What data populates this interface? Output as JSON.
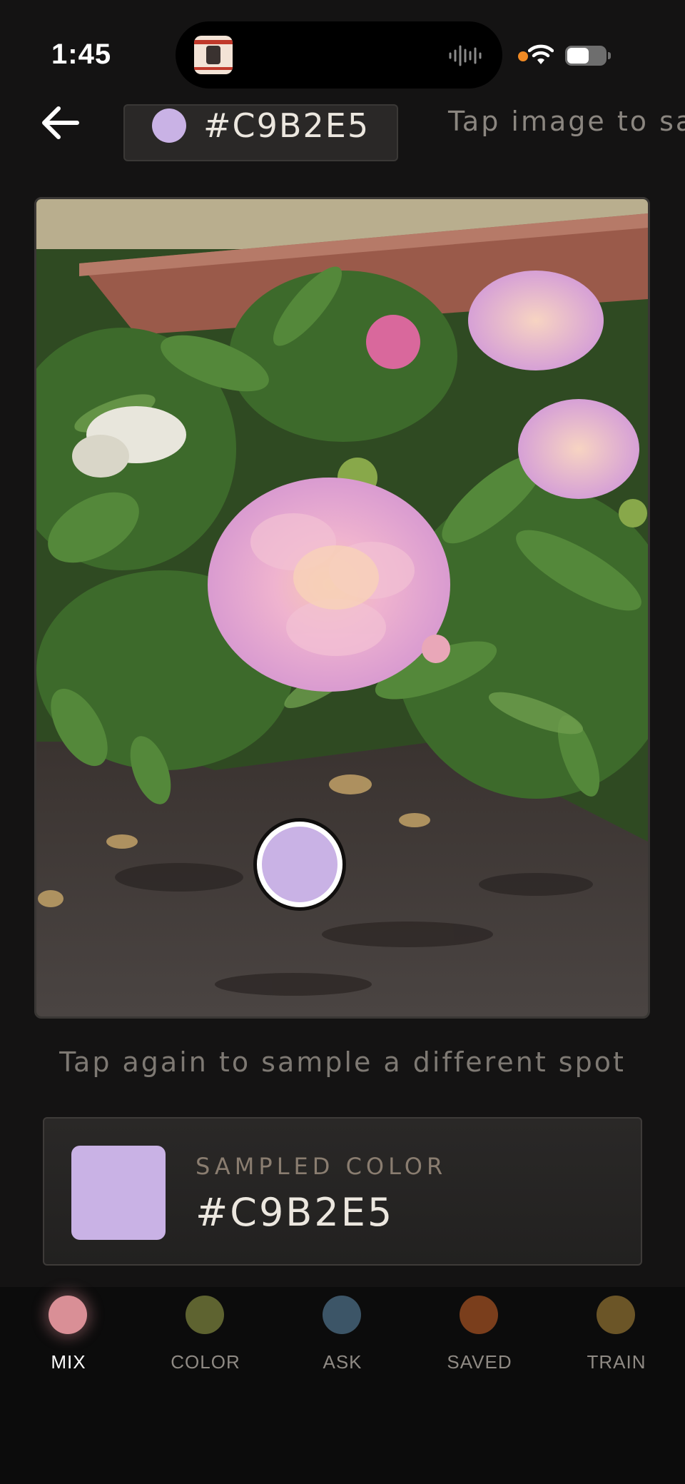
{
  "status_bar": {
    "time": "1:45"
  },
  "header": {
    "selected_hex": "#C9B2E5",
    "hint": "Tap image to sa"
  },
  "photo": {
    "subject": "pink peony bush photo",
    "sample_color": "#C9B2E5"
  },
  "hint_bottom": "Tap again to sample a different spot",
  "sampled": {
    "label": "SAMPLED COLOR",
    "hex": "#C9B2E5",
    "color": "#C9B2E5"
  },
  "nav": {
    "items": [
      {
        "label": "MIX",
        "color": "#d98f96",
        "active": true
      },
      {
        "label": "COLOR",
        "color": "#5e6330",
        "active": false
      },
      {
        "label": "ASK",
        "color": "#3c5567",
        "active": false
      },
      {
        "label": "SAVED",
        "color": "#7a3e1c",
        "active": false
      },
      {
        "label": "TRAIN",
        "color": "#6b5527",
        "active": false
      }
    ]
  }
}
